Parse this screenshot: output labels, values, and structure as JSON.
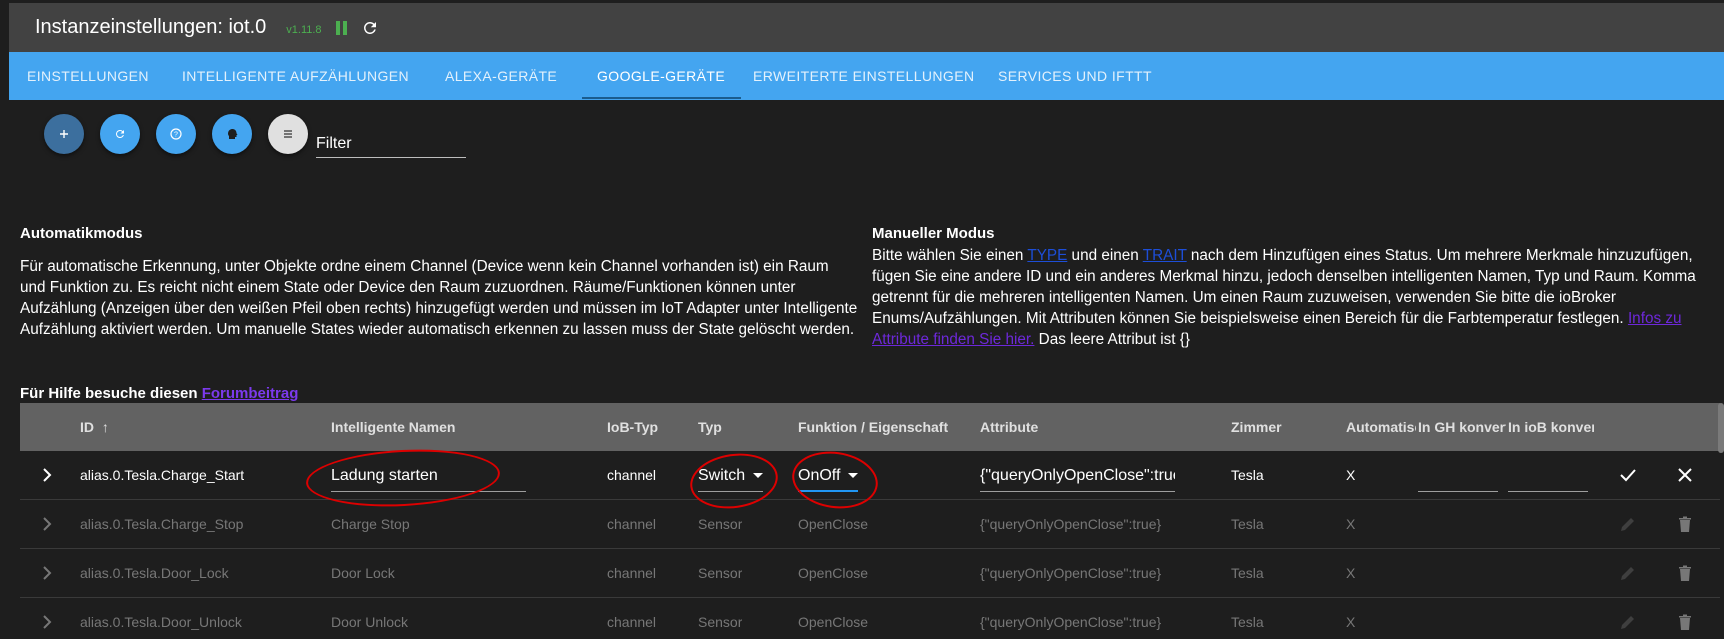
{
  "header": {
    "title": "Instanzeinstellungen: iot.0",
    "version": "v1.11.8"
  },
  "tabs": [
    {
      "label": "EINSTELLUNGEN"
    },
    {
      "label": "INTELLIGENTE AUFZÄHLUNGEN"
    },
    {
      "label": "ALEXA-GERÄTE"
    },
    {
      "label": "GOOGLE-GERÄTE"
    },
    {
      "label": "ERWEITERTE EINSTELLUNGEN"
    },
    {
      "label": "SERVICES UND IFTTT"
    }
  ],
  "toolbar": {
    "filter_placeholder": "Filter",
    "icons": [
      "add-icon",
      "refresh-icon",
      "help-icon",
      "head-icon",
      "list-icon"
    ]
  },
  "auto": {
    "title": "Automatikmodus",
    "text": "Für automatische Erkennung, unter Objekte ordne einem Channel (Device wenn kein Channel vorhanden ist) ein Raum und Funktion zu. Es reicht nicht einem State oder Device den Raum zuzuordnen. Räume/Funktionen können unter Aufzählung (Anzeigen über den weißen Pfeil oben rechts) hinzugefügt werden und müssen im IoT Adapter unter Intelligente Aufzählung aktiviert werden. Um manuelle States wieder automatisch erkennen zu lassen muss der State gelöscht werden.",
    "help_prefix": "Für Hilfe besuche diesen",
    "help_link": "Forumbeitrag"
  },
  "manual": {
    "title": "Manueller Modus",
    "t1": "Bitte wählen Sie einen ",
    "link_type": "TYPE",
    "t2": " und einen ",
    "link_trait": "TRAIT",
    "t3": " nach dem Hinzufügen eines Status. Um mehrere Merkmale hinzuzufügen, fügen Sie eine andere ID und ein anderes Merkmal hinzu, jedoch denselben intelligenten Namen, Typ und Raum. Komma getrennt für die mehreren intelligenten Namen. Um einen Raum zuzuweisen, verwenden Sie bitte die ioBroker Enums/Aufzählungen. Mit Attributen können Sie beispielsweise einen Bereich für die Farbtemperatur festlegen. ",
    "link_infos": "Infos zu Attribute finden Sie hier.",
    "t4": " Das leere Attribut ist {}"
  },
  "table": {
    "headers": {
      "id": "ID",
      "names": "Intelligente Namen",
      "iobtype": "IoB-Typ",
      "typ": "Typ",
      "funktion": "Funktion / Eigenschaft",
      "attribute": "Attribute",
      "zimmer": "Zimmer",
      "auto": "Automatisch",
      "ghconv": "In GH konvertieren",
      "iobconv": "In ioB konvertieren"
    },
    "edit_row": {
      "id": "alias.0.Tesla.Charge_Start",
      "name": "Ladung starten",
      "iobtype": "channel",
      "typ": "Switch",
      "funktion": "OnOff",
      "attribute": "{\"queryOnlyOpenClose\":true}",
      "zimmer": "Tesla",
      "auto": "X"
    },
    "rows": [
      {
        "id": "alias.0.Tesla.Charge_Stop",
        "name": "Charge Stop",
        "iobtype": "channel",
        "typ": "Sensor",
        "funktion": "OpenClose",
        "attribute": "{\"queryOnlyOpenClose\":true}",
        "zimmer": "Tesla",
        "auto": "X"
      },
      {
        "id": "alias.0.Tesla.Door_Lock",
        "name": "Door Lock",
        "iobtype": "channel",
        "typ": "Sensor",
        "funktion": "OpenClose",
        "attribute": "{\"queryOnlyOpenClose\":true}",
        "zimmer": "Tesla",
        "auto": "X"
      },
      {
        "id": "alias.0.Tesla.Door_Unlock",
        "name": "Door Unlock",
        "iobtype": "channel",
        "typ": "Sensor",
        "funktion": "OpenClose",
        "attribute": "{\"queryOnlyOpenClose\":true}",
        "zimmer": "Tesla",
        "auto": "X"
      }
    ]
  },
  "colors": {
    "tabbar": "#44a5f0",
    "titlebar": "#424242",
    "background": "#1e1e1e",
    "annotation": "#dd0000",
    "version": "#4caf50"
  }
}
